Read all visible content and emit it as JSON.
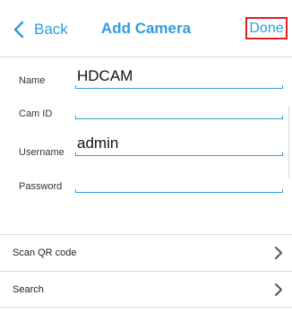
{
  "navbar": {
    "back_label": "Back",
    "title": "Add Camera",
    "done_label": "Done",
    "accent_color": "#2f9de0",
    "done_outline_color": "#e02020"
  },
  "form": {
    "name_label": "Name",
    "name_value": "HDCAM",
    "camid_label": "Cam ID",
    "camid_value": "",
    "username_label": "Username",
    "username_value": "admin",
    "password_label": "Password",
    "password_value": ""
  },
  "rows": {
    "scan_label": "Scan QR code",
    "search_label": "Search"
  },
  "icons": {
    "back": "chevron-left-icon",
    "row_arrow": "chevron-right-icon"
  }
}
